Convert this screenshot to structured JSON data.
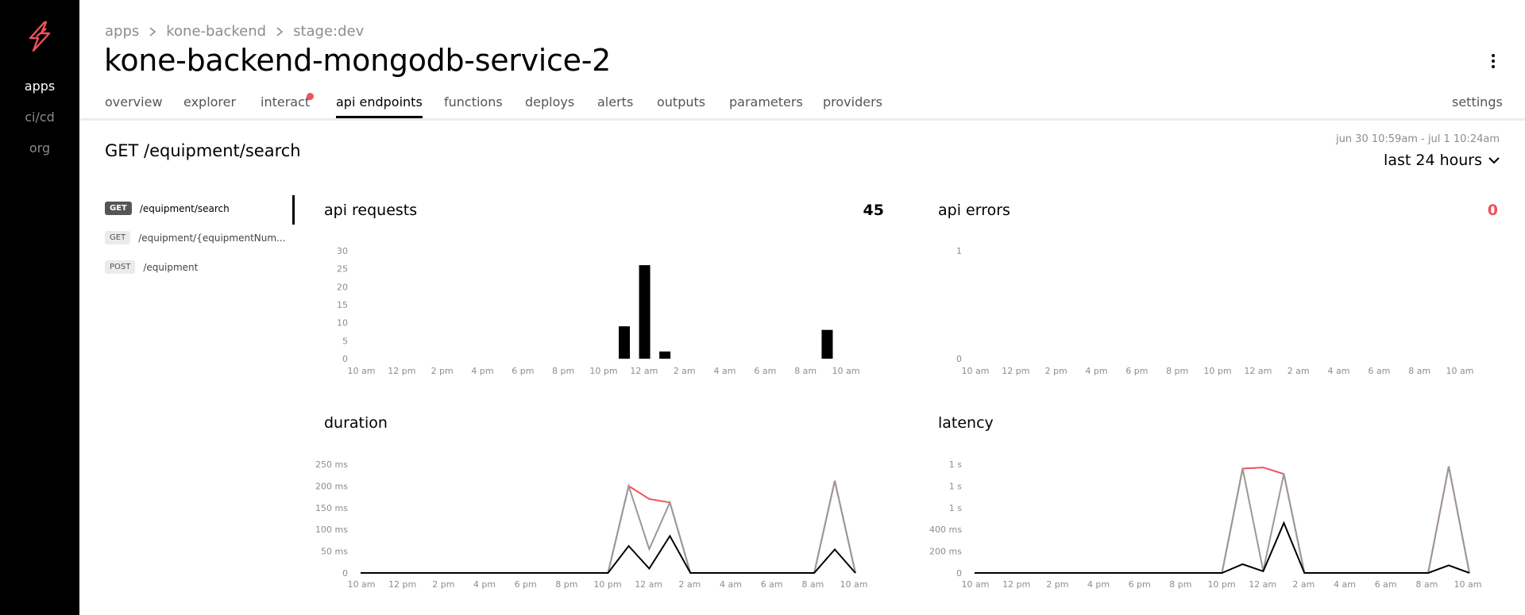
{
  "sidebar": {
    "items": [
      {
        "label": "apps",
        "active": true
      },
      {
        "label": "ci/cd",
        "active": false
      },
      {
        "label": "org",
        "active": false
      }
    ],
    "logo": "lightning-bolt-logo"
  },
  "breadcrumb": [
    "apps",
    "kone-backend",
    "stage:dev"
  ],
  "page_title": "kone-backend-mongodb-service-2",
  "tabs": [
    {
      "label": "overview"
    },
    {
      "label": "explorer"
    },
    {
      "label": "interact",
      "notification_dot": true
    },
    {
      "label": "api endpoints",
      "active": true
    },
    {
      "label": "functions"
    },
    {
      "label": "deploys"
    },
    {
      "label": "alerts"
    },
    {
      "label": "outputs"
    },
    {
      "label": "parameters"
    },
    {
      "label": "providers"
    }
  ],
  "settings_label": "settings",
  "endpoint_heading": "GET /equipment/search",
  "date_range": "jun 30 10:59am - jul 1 10:24am",
  "range_select": "last 24 hours",
  "endpoints": [
    {
      "method": "GET",
      "path": "/equipment/search",
      "active": true
    },
    {
      "method": "GET",
      "path": "/equipment/{equipmentNum..."
    },
    {
      "method": "POST",
      "path": "/equipment"
    }
  ],
  "colors": {
    "accent": "#f0525b",
    "series_black": "#000000",
    "series_gray": "#999999",
    "sidebar_bg": "#000000"
  },
  "chart_data": [
    {
      "id": "api-requests",
      "type": "bar",
      "title": "api requests",
      "metric": "45",
      "x_labels": [
        "10 am",
        "12 pm",
        "2 pm",
        "4 pm",
        "6 pm",
        "8 pm",
        "10 pm",
        "12 am",
        "2 am",
        "4 am",
        "6 am",
        "8 am",
        "10 am"
      ],
      "y_ticks": [
        "0",
        "5",
        "10",
        "15",
        "20",
        "25",
        "30"
      ],
      "ylim": [
        0,
        30
      ],
      "series": [
        {
          "values": [
            0,
            0,
            0,
            0,
            0,
            0,
            0,
            0,
            0,
            0,
            0,
            0,
            0,
            9,
            26,
            2,
            0,
            0,
            0,
            0,
            0,
            0,
            0,
            8,
            0
          ]
        }
      ]
    },
    {
      "id": "api-errors",
      "type": "bar",
      "title": "api errors",
      "metric": "0",
      "x_labels": [
        "10 am",
        "12 pm",
        "2 pm",
        "4 pm",
        "6 pm",
        "8 pm",
        "10 pm",
        "12 am",
        "2 am",
        "4 am",
        "6 am",
        "8 am",
        "10 am"
      ],
      "y_ticks": [
        "0",
        "1"
      ],
      "ylim": [
        0,
        1
      ],
      "series": [
        {
          "values": [
            0,
            0,
            0,
            0,
            0,
            0,
            0,
            0,
            0,
            0,
            0,
            0,
            0,
            0,
            0,
            0,
            0,
            0,
            0,
            0,
            0,
            0,
            0,
            0,
            0
          ]
        }
      ]
    },
    {
      "id": "duration",
      "type": "line",
      "title": "duration",
      "x_labels": [
        "10 am",
        "12 pm",
        "2 pm",
        "4 pm",
        "6 pm",
        "8 pm",
        "10 pm",
        "12 am",
        "2 am",
        "4 am",
        "6 am",
        "8 am",
        "10 am"
      ],
      "y_ticks": [
        "0",
        "50 ms",
        "100 ms",
        "150 ms",
        "200 ms",
        "250 ms"
      ],
      "ylim": [
        0,
        250
      ],
      "series": [
        {
          "color": "#f0525b",
          "values": [
            0,
            0,
            0,
            0,
            0,
            0,
            0,
            0,
            0,
            0,
            0,
            0,
            0,
            200,
            170,
            162,
            0,
            0,
            0,
            0,
            0,
            0,
            0,
            212,
            0
          ]
        },
        {
          "color": "#999999",
          "values": [
            0,
            0,
            0,
            0,
            0,
            0,
            0,
            0,
            0,
            0,
            0,
            0,
            0,
            200,
            55,
            162,
            0,
            0,
            0,
            0,
            0,
            0,
            0,
            212,
            0
          ]
        },
        {
          "color": "#000000",
          "values": [
            0,
            0,
            0,
            0,
            0,
            0,
            0,
            0,
            0,
            0,
            0,
            0,
            0,
            62,
            10,
            85,
            0,
            0,
            0,
            0,
            0,
            0,
            0,
            54,
            0
          ]
        }
      ]
    },
    {
      "id": "latency",
      "type": "line",
      "title": "latency",
      "x_labels": [
        "10 am",
        "12 pm",
        "2 pm",
        "4 pm",
        "6 pm",
        "8 pm",
        "10 pm",
        "12 am",
        "2 am",
        "4 am",
        "6 am",
        "8 am",
        "10 am"
      ],
      "y_ticks": [
        "0",
        "200 ms",
        "400 ms",
        "1 s",
        "1 s",
        "1 s"
      ],
      "ylim": [
        0,
        1000
      ],
      "series": [
        {
          "color": "#f0525b",
          "values": [
            0,
            0,
            0,
            0,
            0,
            0,
            0,
            0,
            0,
            0,
            0,
            0,
            0,
            960,
            970,
            910,
            0,
            0,
            0,
            0,
            0,
            0,
            0,
            980,
            0
          ]
        },
        {
          "color": "#999999",
          "values": [
            0,
            0,
            0,
            0,
            0,
            0,
            0,
            0,
            0,
            0,
            0,
            0,
            0,
            960,
            20,
            910,
            0,
            0,
            0,
            0,
            0,
            0,
            0,
            980,
            0
          ]
        },
        {
          "color": "#000000",
          "values": [
            0,
            0,
            0,
            0,
            0,
            0,
            0,
            0,
            0,
            0,
            0,
            0,
            0,
            80,
            15,
            460,
            0,
            0,
            0,
            0,
            0,
            0,
            0,
            70,
            0
          ]
        }
      ]
    }
  ]
}
